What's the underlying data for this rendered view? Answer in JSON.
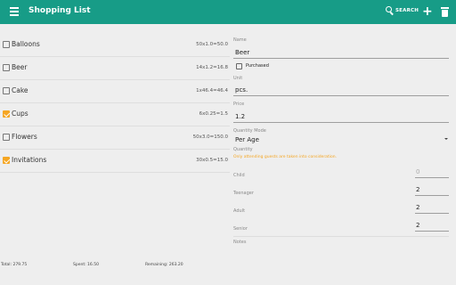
{
  "appbar": {
    "title": "Shopping List",
    "menu_icon": "hamburger-menu-icon",
    "search_label": "SEARCH",
    "search_icon": "search-icon",
    "add_icon": "add-icon",
    "delete_icon": "delete-icon",
    "color": "#179c87"
  },
  "items": [
    {
      "name": "Balloons",
      "formula": "50x1.0=50.0",
      "checked": false
    },
    {
      "name": "Beer",
      "formula": "14x1.2=16.8",
      "checked": false
    },
    {
      "name": "Cake",
      "formula": "1x46.4=46.4",
      "checked": false
    },
    {
      "name": "Cups",
      "formula": "6x0.25=1.5",
      "checked": true
    },
    {
      "name": "Flowers",
      "formula": "50x3.0=150.0",
      "checked": false
    },
    {
      "name": "Invitations",
      "formula": "30x0.5=15.0",
      "checked": true
    }
  ],
  "detail": {
    "name_label": "Name",
    "name_value": "Beer",
    "purchased_label": "Purchased",
    "unit_label": "Unit",
    "unit_value": "pcs.",
    "price_label": "Price",
    "price_value": "1.2",
    "mode_label": "Quantity Mode",
    "mode_value": "Per Age",
    "quantity_label": "Quantity",
    "hint": "Only attending guests are taken into consideration.",
    "child_label": "Child",
    "child_value": "0",
    "teenager_label": "Teenager",
    "teenager_value": "2",
    "adult_label": "Adult",
    "adult_value": "2",
    "senior_label": "Senior",
    "senior_value": "2",
    "notes_label": "Notes"
  },
  "footer": {
    "total": "Total: 279.75",
    "spent": "Spent: 16.50",
    "remaining": "Remaining: 263.20"
  }
}
